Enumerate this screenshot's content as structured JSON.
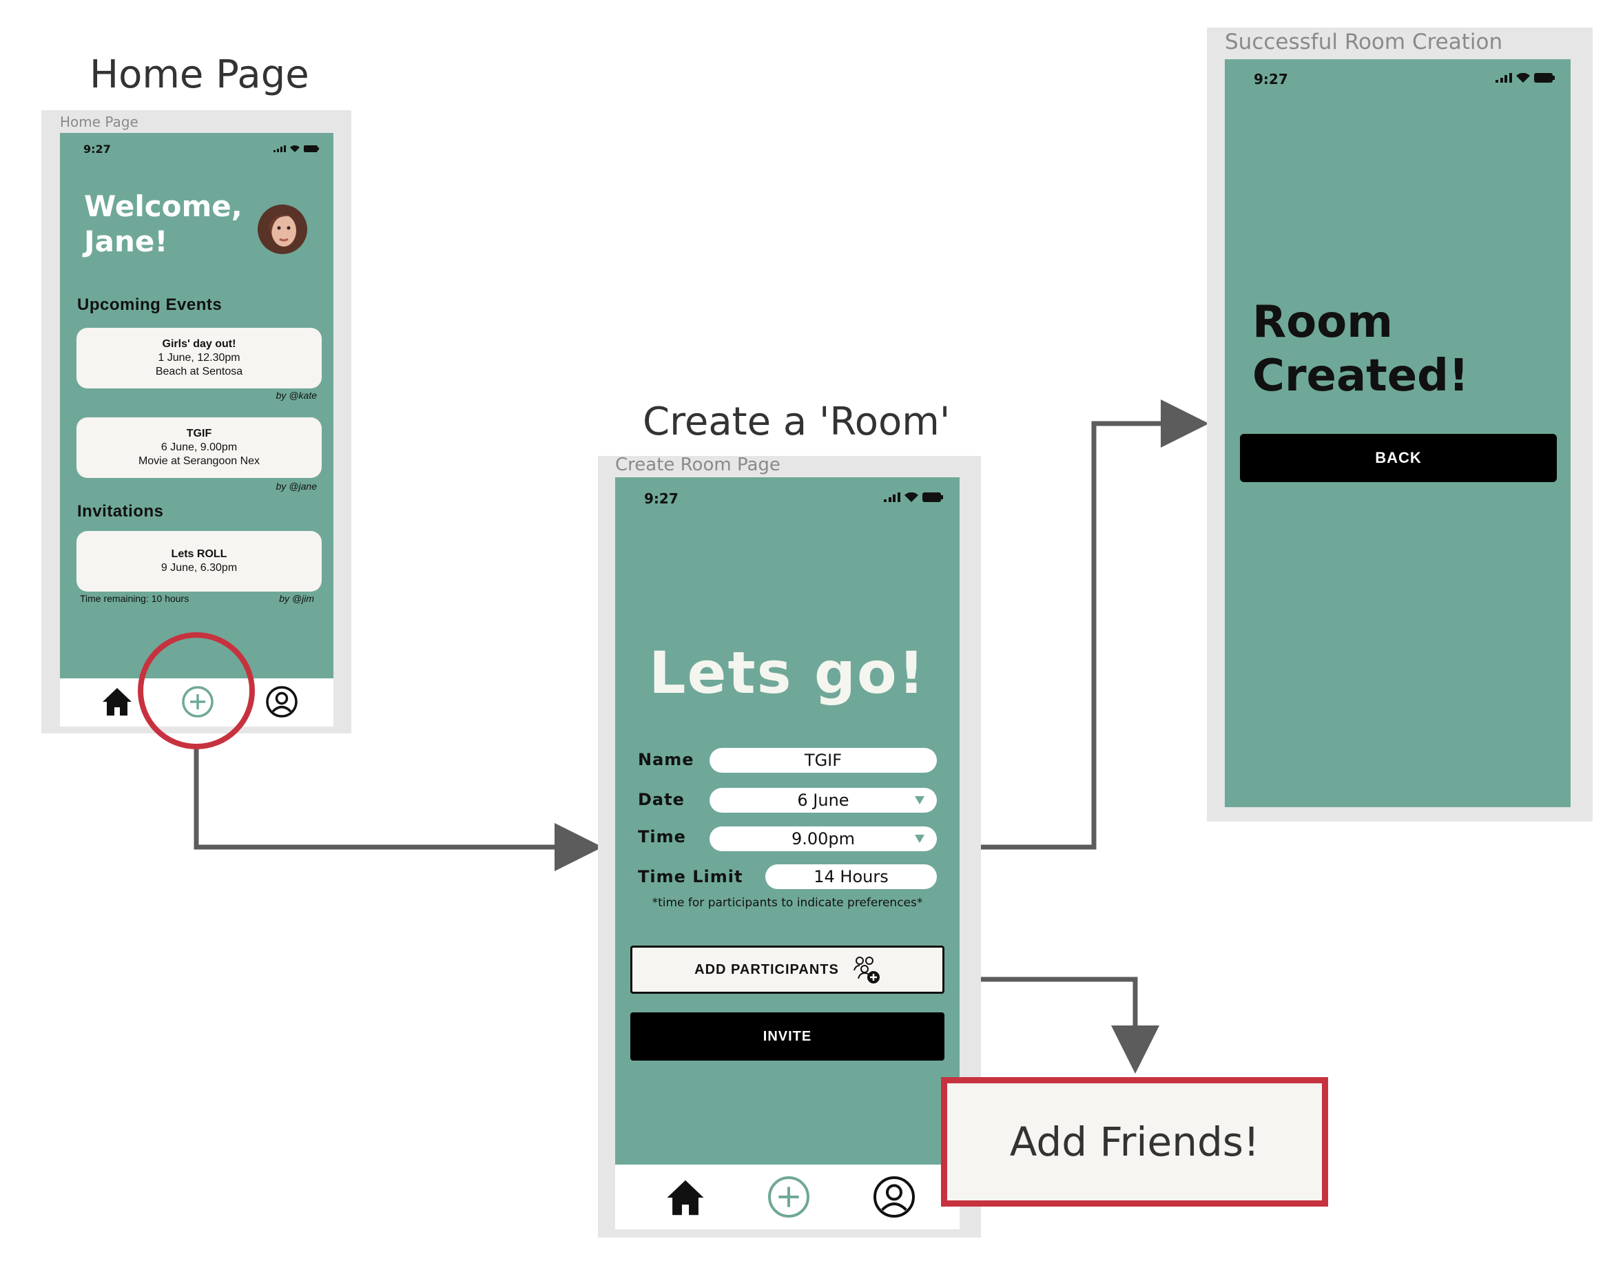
{
  "titles": {
    "home": "Home Page",
    "create": "Create a 'Room'"
  },
  "home_frame": {
    "label": "Home Page",
    "time": "9:27",
    "welcome_line1": "Welcome,",
    "welcome_line2": "Jane!",
    "upcoming_heading": "Upcoming Events",
    "events": [
      {
        "title": "Girls' day out!",
        "when": "1 June, 12.30pm",
        "where": "Beach at Sentosa",
        "by": "by @kate"
      },
      {
        "title": "TGIF",
        "when": "6 June, 9.00pm",
        "where": "Movie at Serangoon Nex",
        "by": "by @jane"
      }
    ],
    "invitations_heading": "Invitations",
    "invitation": {
      "title": "Lets ROLL",
      "when": "9 June, 6.30pm",
      "remaining": "Time remaining: 10 hours",
      "by": "by @jim"
    }
  },
  "create_frame": {
    "label": "Create Room Page",
    "time": "9:27",
    "headline": "Lets go!",
    "fields": {
      "name_label": "Name",
      "name_value": "TGIF",
      "date_label": "Date",
      "date_value": "6 June",
      "time_label": "Time",
      "time_value": "9.00pm",
      "limit_label": "Time Limit",
      "limit_value": "14 Hours"
    },
    "hint": "*time for participants to indicate preferences*",
    "add_participants": "ADD PARTICIPANTS",
    "invite": "INVITE"
  },
  "success_frame": {
    "label": "Successful Room Creation",
    "time": "9:27",
    "line1": "Room",
    "line2": "Created!",
    "back": "BACK"
  },
  "callout": {
    "text": "Add Friends!"
  },
  "icons": [
    "home-icon",
    "plus-circle-icon",
    "profile-icon",
    "signal-icon",
    "wifi-icon",
    "battery-icon",
    "add-people-icon",
    "avatar"
  ],
  "colors": {
    "screen": "#6fa898",
    "frame": "#e6e6e6",
    "highlight": "#c7323f",
    "connector": "#5c5c5c",
    "card": "#f7f5f1"
  }
}
